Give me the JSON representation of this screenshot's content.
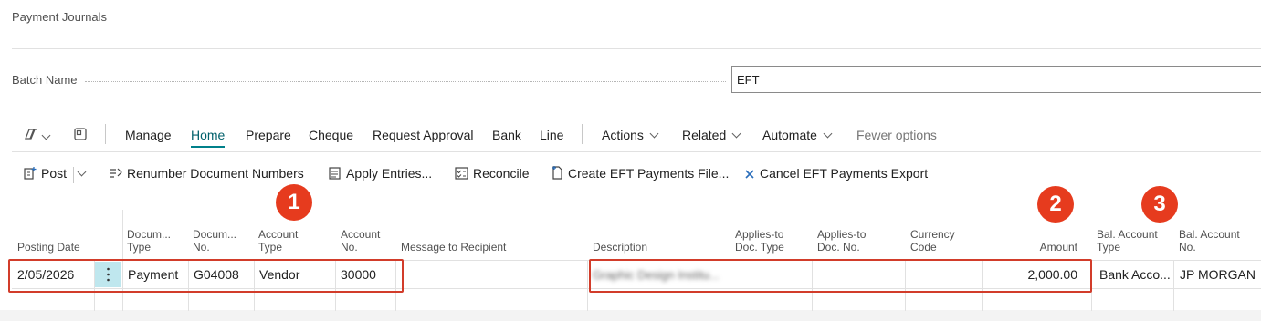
{
  "page": {
    "title": "Payment Journals"
  },
  "batch": {
    "label": "Batch Name",
    "value": "EFT"
  },
  "actionbar": {
    "tabs": [
      "Manage",
      "Home",
      "Prepare",
      "Cheque",
      "Request Approval",
      "Bank",
      "Line"
    ],
    "active_tab": "Home",
    "menus": [
      "Actions",
      "Related",
      "Automate"
    ],
    "fewer_options": "Fewer options"
  },
  "toolbar": {
    "post": "Post",
    "renumber": "Renumber Document Numbers",
    "apply_entries": "Apply Entries...",
    "reconcile": "Reconcile",
    "create_eft": "Create EFT Payments File...",
    "cancel_eft": "Cancel EFT Payments Export"
  },
  "columns": {
    "posting_date": "Posting Date",
    "doc_type_1": "Docum...",
    "doc_type_2": "Type",
    "doc_no_1": "Docum...",
    "doc_no_2": "No.",
    "acct_type_1": "Account",
    "acct_type_2": "Type",
    "acct_no_1": "Account",
    "acct_no_2": "No.",
    "message": "Message to Recipient",
    "description": "Description",
    "applies_type_1": "Applies-to",
    "applies_type_2": "Doc. Type",
    "applies_no_1": "Applies-to",
    "applies_no_2": "Doc. No.",
    "currency_1": "Currency",
    "currency_2": "Code",
    "amount": "Amount",
    "bal_type_1": "Bal. Account",
    "bal_type_2": "Type",
    "bal_no_1": "Bal. Account",
    "bal_no_2": "No."
  },
  "row": {
    "posting_date": "2/05/2026",
    "document_type": "Payment",
    "document_no": "G04008",
    "account_type": "Vendor",
    "account_no": "30000",
    "description": "Graphic Design Institu...",
    "amount": "2,000.00",
    "bal_account_type": "Bank Acco...",
    "bal_account_no": "JP MORGAN"
  },
  "annotations": {
    "badge_1": "1",
    "badge_2": "2",
    "badge_3": "3"
  },
  "colors": {
    "accent": "#00808a",
    "callout": "#e63b1e"
  }
}
